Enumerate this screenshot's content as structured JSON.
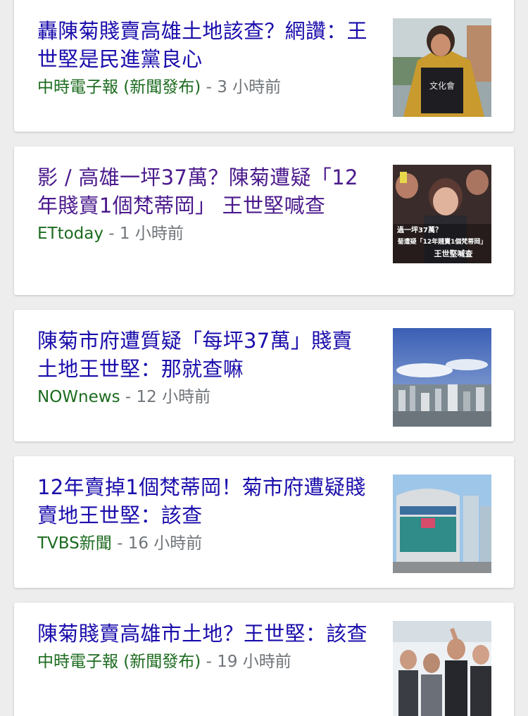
{
  "colors": {
    "headline": "#1a0dab",
    "visited_headline": "#4b1a8c",
    "source": "#1c6b1f",
    "time": "#70757a",
    "background": "#ededed",
    "card": "#ffffff"
  },
  "articles": [
    {
      "headline": "轟陳菊賤賣高雄土地該查？網讚：王世堅是民進黨良心",
      "source": "中時電子報 (新聞發布)",
      "separator": " - ",
      "time": "3 小時前",
      "thumbnail_text": "文化會",
      "visited": false
    },
    {
      "headline": "影 / 高雄一坪37萬？陳菊遭疑「12年賤賣1個梵蒂岡」 王世堅喊查",
      "source": "ETtoday",
      "separator": " - ",
      "time": "1 小時前",
      "thumbnail_text_lines": [
        "過一坪37萬？",
        "菊遭疑「12年賤賣1個梵蒂岡」",
        "王世堅喊查"
      ],
      "visited": true
    },
    {
      "headline": "陳菊市府遭質疑「每坪37萬」賤賣土地王世堅：那就查嘛",
      "source": "NOWnews",
      "separator": " - ",
      "time": "12 小時前",
      "visited": false
    },
    {
      "headline": "12年賣掉1個梵蒂岡！菊市府遭疑賤賣地王世堅：該查",
      "source": "TVBS新聞",
      "separator": " - ",
      "time": "16 小時前",
      "visited": false
    },
    {
      "headline": "陳菊賤賣高雄市土地？王世堅：該查",
      "source": "中時電子報 (新聞發布)",
      "separator": " - ",
      "time": "19 小時前",
      "visited": false
    }
  ]
}
